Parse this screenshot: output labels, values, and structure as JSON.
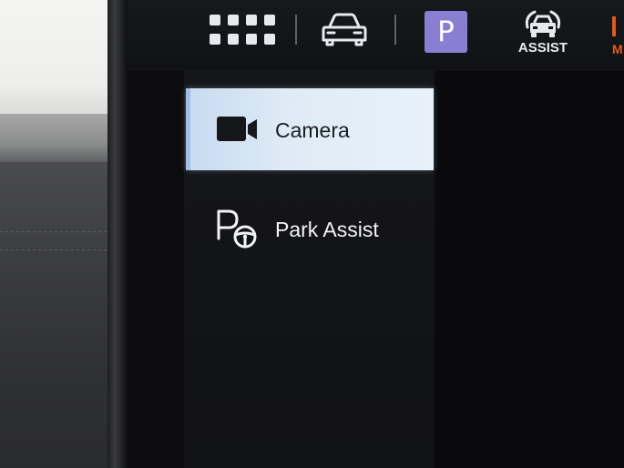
{
  "topbar": {
    "apps_icon": "apps-grid-icon",
    "vehicle_icon": "car-front-icon",
    "park_button": {
      "label": "P",
      "color": "#8a7ed3"
    },
    "assist_button": {
      "label": "ASSIST",
      "icon": "assist-car-sensor-icon"
    }
  },
  "menu": {
    "items": [
      {
        "label": "Camera",
        "icon": "camera-icon",
        "selected": true
      },
      {
        "label": "Park Assist",
        "icon": "park-assist-steering-icon",
        "selected": false
      }
    ]
  },
  "colors": {
    "selected_bg": "#deebf6",
    "accent_orange": "#e05a1e",
    "screen_bg": "#0c0c0e"
  }
}
